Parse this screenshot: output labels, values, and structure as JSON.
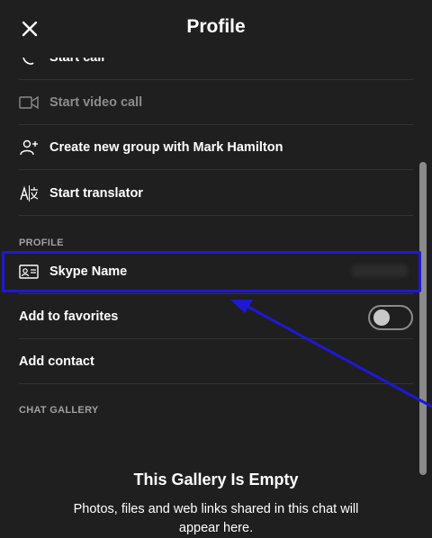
{
  "header": {
    "title": "Profile"
  },
  "actions": [
    {
      "label": "Start call",
      "icon": "phone-icon"
    },
    {
      "label": "Start video call",
      "icon": "video-camera-icon"
    },
    {
      "label": "Create new group with Mark Hamilton",
      "icon": "group-add-icon"
    },
    {
      "label": "Start translator",
      "icon": "translate-icon"
    }
  ],
  "profile_section": {
    "label": "PROFILE",
    "skype_name_label": "Skype Name"
  },
  "favorites": {
    "label": "Add to favorites",
    "enabled": false
  },
  "add_contact": {
    "label": "Add contact"
  },
  "chat_gallery": {
    "label": "CHAT GALLERY",
    "empty_title": "This Gallery Is Empty",
    "empty_description": "Photos, files and web links shared in this chat will appear here."
  },
  "colors": {
    "highlight": "#1e18d6",
    "arrow": "#1e18d6",
    "background": "#1f1f1f"
  }
}
